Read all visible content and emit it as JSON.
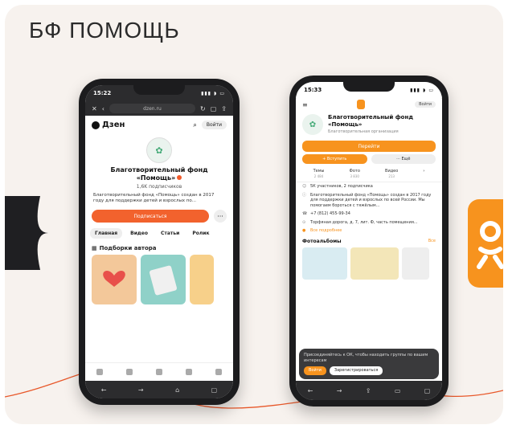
{
  "slide": {
    "title": "БФ ПОМОЩЬ"
  },
  "colors": {
    "background": "#f7f2ee",
    "dzen_orange": "#f2622d",
    "ok_orange": "#f7931e",
    "curve": "#e8582a"
  },
  "phone_dzen": {
    "time": "15:22",
    "url": "dzen.ru",
    "logo": "Дзен",
    "signin": "Войти",
    "channel_name": "Благотворительный фонд «Помощь»",
    "subscribers": "1,6K подписчиков",
    "description": "Благотворительный фонд «Помощь» создан в 2017 году для поддержки детей и взрослых по...",
    "subscribe": "Подписаться",
    "tabs": [
      "Главная",
      "Видео",
      "Статьи",
      "Ролик"
    ],
    "section": "Подборки автора"
  },
  "phone_ok": {
    "time": "15:33",
    "login": "Войти",
    "group_name": "Благотворительный фонд «Помощь»",
    "group_type": "Благотворительная организация",
    "join": "Перейти",
    "btn_left": "+ Вступить",
    "btn_right": "··· Ещё",
    "stats": [
      {
        "label": "Темы",
        "value": "2 484"
      },
      {
        "label": "Фото",
        "value": "3 830"
      },
      {
        "label": "Видео",
        "value": "213"
      }
    ],
    "members": "5К участников, 2 подписчика",
    "about": "Благотворительный фонд «Помощь» создан в 2017 году для поддержки детей и взрослых по всей России. Мы помогаем бороться с тяжёлым...",
    "phone": "+7 (812) 455-99-34",
    "address": "Торфяная дорога, д. 7, лит. Ф, часть помещения...",
    "more": "Все подробнее",
    "photos_title": "Фотоальбомы",
    "photos_all": "Все",
    "cookie_text": "Присоединяйтесь к ОК, чтобы находить группы по вашим интересам",
    "cookie_login": "Войти",
    "cookie_register": "Зарегистрироваться"
  }
}
